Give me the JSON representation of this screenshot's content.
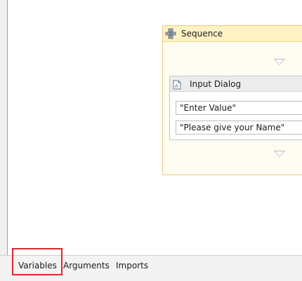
{
  "sequence": {
    "title": "Sequence",
    "icon": "sequence-icon"
  },
  "input_dialog": {
    "title": "Input Dialog",
    "icon": "input-dialog-icon",
    "fields": [
      {
        "value": "\"Enter Value\""
      },
      {
        "value": "\"Please give your Name\""
      }
    ]
  },
  "bottom_tabs": [
    {
      "label": "Variables"
    },
    {
      "label": "Arguments"
    },
    {
      "label": "Imports"
    }
  ],
  "colors": {
    "highlight": "#e0262b",
    "sequence_border": "#e6c97a",
    "sequence_header": "#fff2c4"
  }
}
